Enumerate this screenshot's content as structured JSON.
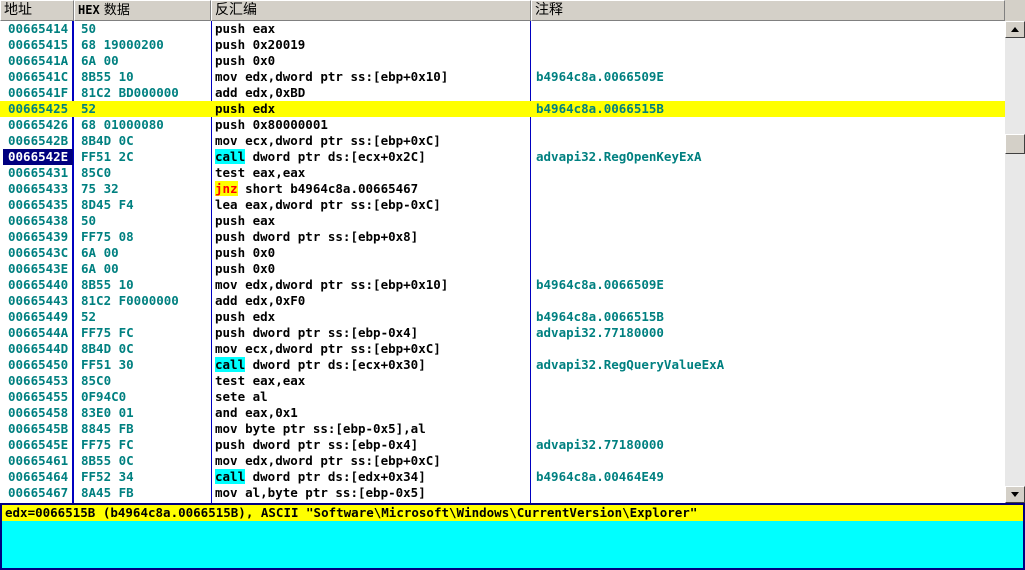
{
  "header": {
    "address": "地址",
    "hex_prefix": "HEX",
    "hex_suffix": " 数据",
    "disasm": "反汇编",
    "comment": "注释"
  },
  "rows": [
    {
      "addr": "00665414",
      "hex": "50",
      "asm": "push eax",
      "cmt": ""
    },
    {
      "addr": "00665415",
      "hex": "68 19000200",
      "asm": "push 0x20019",
      "cmt": ""
    },
    {
      "addr": "0066541A",
      "hex": "6A 00",
      "asm": "push 0x0",
      "cmt": ""
    },
    {
      "addr": "0066541C",
      "hex": "8B55 10",
      "asm": "mov edx,dword ptr ss:[ebp+0x10]",
      "cmt": "b4964c8a.0066509E"
    },
    {
      "addr": "0066541F",
      "hex": "81C2 BD000000",
      "asm": "add edx,0xBD",
      "cmt": ""
    },
    {
      "addr": "00665425",
      "hex": "52",
      "asm": "push edx",
      "cmt": "b4964c8a.0066515B",
      "highlight": true
    },
    {
      "addr": "00665426",
      "hex": "68 01000080",
      "asm": "push 0x80000001",
      "cmt": ""
    },
    {
      "addr": "0066542B",
      "hex": "8B4D 0C",
      "asm": "mov ecx,dword ptr ss:[ebp+0xC]",
      "cmt": ""
    },
    {
      "addr": "0066542E",
      "hex": "FF51 2C",
      "kw": "call",
      "asm": " dword ptr ds:[ecx+0x2C]",
      "cmt": "advapi32.RegOpenKeyExA",
      "selected": true
    },
    {
      "addr": "00665431",
      "hex": "85C0",
      "asm": "test eax,eax",
      "cmt": ""
    },
    {
      "addr": "00665433",
      "hex": "75 32",
      "kw": "jnz",
      "asm": " short b4964c8a.00665467",
      "cmt": "",
      "jump": true
    },
    {
      "addr": "00665435",
      "hex": "8D45 F4",
      "asm": "lea eax,dword ptr ss:[ebp-0xC]",
      "cmt": ""
    },
    {
      "addr": "00665438",
      "hex": "50",
      "asm": "push eax",
      "cmt": ""
    },
    {
      "addr": "00665439",
      "hex": "FF75 08",
      "asm": "push dword ptr ss:[ebp+0x8]",
      "cmt": ""
    },
    {
      "addr": "0066543C",
      "hex": "6A 00",
      "asm": "push 0x0",
      "cmt": ""
    },
    {
      "addr": "0066543E",
      "hex": "6A 00",
      "asm": "push 0x0",
      "cmt": ""
    },
    {
      "addr": "00665440",
      "hex": "8B55 10",
      "asm": "mov edx,dword ptr ss:[ebp+0x10]",
      "cmt": "b4964c8a.0066509E"
    },
    {
      "addr": "00665443",
      "hex": "81C2 F0000000",
      "asm": "add edx,0xF0",
      "cmt": ""
    },
    {
      "addr": "00665449",
      "hex": "52",
      "asm": "push edx",
      "cmt": "b4964c8a.0066515B"
    },
    {
      "addr": "0066544A",
      "hex": "FF75 FC",
      "asm": "push dword ptr ss:[ebp-0x4]",
      "cmt": "advapi32.77180000"
    },
    {
      "addr": "0066544D",
      "hex": "8B4D 0C",
      "asm": "mov ecx,dword ptr ss:[ebp+0xC]",
      "cmt": ""
    },
    {
      "addr": "00665450",
      "hex": "FF51 30",
      "kw": "call",
      "asm": " dword ptr ds:[ecx+0x30]",
      "cmt": "advapi32.RegQueryValueExA"
    },
    {
      "addr": "00665453",
      "hex": "85C0",
      "asm": "test eax,eax",
      "cmt": ""
    },
    {
      "addr": "00665455",
      "hex": "0F94C0",
      "asm": "sete al",
      "cmt": ""
    },
    {
      "addr": "00665458",
      "hex": "83E0 01",
      "asm": "and eax,0x1",
      "cmt": ""
    },
    {
      "addr": "0066545B",
      "hex": "8845 FB",
      "asm": "mov byte ptr ss:[ebp-0x5],al",
      "cmt": ""
    },
    {
      "addr": "0066545E",
      "hex": "FF75 FC",
      "asm": "push dword ptr ss:[ebp-0x4]",
      "cmt": "advapi32.77180000"
    },
    {
      "addr": "00665461",
      "hex": "8B55 0C",
      "asm": "mov edx,dword ptr ss:[ebp+0xC]",
      "cmt": ""
    },
    {
      "addr": "00665464",
      "hex": "FF52 34",
      "kw": "call",
      "asm": " dword ptr ds:[edx+0x34]",
      "cmt": "b4964c8a.00464E49"
    },
    {
      "addr": "00665467",
      "hex": "8A45 FB",
      "asm": "mov al,byte ptr ss:[ebp-0x5]",
      "cmt": ""
    }
  ],
  "info": {
    "line": "edx=0066515B (b4964c8a.0066515B), ASCII \"Software\\Microsoft\\Windows\\CurrentVersion\\Explorer\""
  },
  "colors": {
    "highlight_row": "#ffff00",
    "selected_address": "#000080",
    "call_keyword": "#00ffff",
    "jump_keyword": "#ff0000",
    "info_pane": "#00ffff",
    "text_teal": "#008080"
  }
}
